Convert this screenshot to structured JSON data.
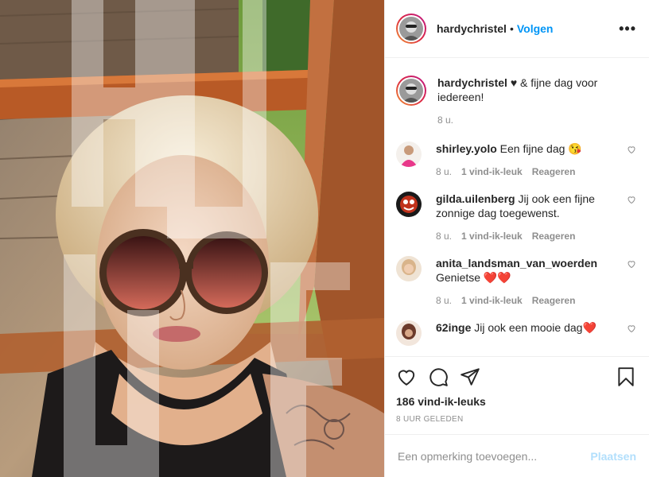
{
  "header": {
    "username": "hardychristel",
    "separator": "•",
    "follow_label": "Volgen",
    "more_label": "•••"
  },
  "caption": {
    "username": "hardychristel",
    "text": "♥ & fijne dag voor iedereen!",
    "time": "8 u."
  },
  "comments": [
    {
      "username": "shirley.yolo",
      "text": "Een fijne dag 😘",
      "time": "8 u.",
      "likes": "1 vind-ik-leuk",
      "reply": "Reageren",
      "avatar_color": "#e8388a"
    },
    {
      "username": "gilda.uilenberg",
      "text": "Jij ook een fijne zonnige dag toegewenst.",
      "time": "8 u.",
      "likes": "1 vind-ik-leuk",
      "reply": "Reageren",
      "avatar_color": "#c0321c"
    },
    {
      "username": "anita_landsman_van_woerden",
      "text": "Genietse ❤️❤️",
      "time": "8 u.",
      "likes": "1 vind-ik-leuk",
      "reply": "Reageren",
      "avatar_color": "#d9b48a"
    },
    {
      "username": "62inge",
      "text": "Jij ook een mooie dag❤️",
      "time": "",
      "likes": "",
      "reply": "",
      "avatar_color": "#6b3a2a"
    }
  ],
  "actions": {
    "likes_count": "186 vind-ik-leuks",
    "timestamp": "8 UUR GELEDEN",
    "icons": [
      "heart-icon",
      "comment-icon",
      "share-icon",
      "bookmark-icon"
    ]
  },
  "add_comment": {
    "placeholder": "Een opmerking toevoegen...",
    "post_label": "Plaatsen"
  },
  "colors": {
    "accent": "#0095f6",
    "post_disabled": "#b2dffc",
    "muted": "#8e8e8e"
  }
}
